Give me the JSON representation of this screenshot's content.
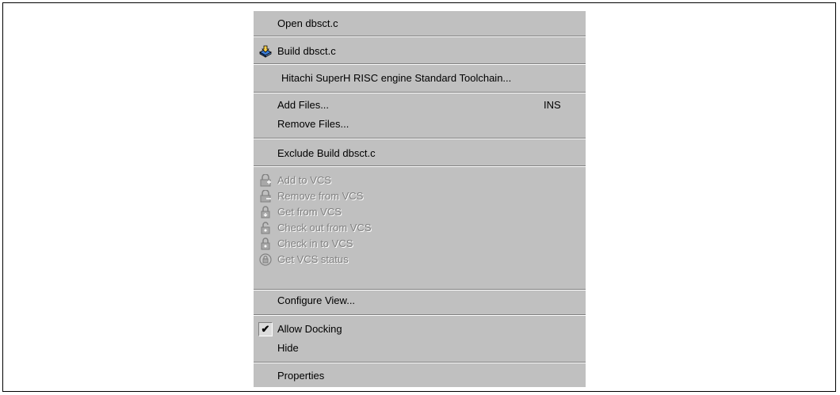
{
  "menu": {
    "open": "Open dbsct.c",
    "build": "Build dbsct.c",
    "toolchain": "Hitachi SuperH RISC engine Standard Toolchain...",
    "add_files": "Add Files...",
    "add_files_shortcut": "INS",
    "remove_files": "Remove Files...",
    "exclude_build": "Exclude Build dbsct.c",
    "vcs": {
      "add": "Add to VCS",
      "remove": "Remove from VCS",
      "get": "Get from VCS",
      "check_out": "Check out from VCS",
      "check_in": "Check in to VCS",
      "status": "Get VCS status"
    },
    "configure_view": "Configure View...",
    "allow_docking": "Allow Docking",
    "allow_docking_checked": "✔",
    "hide": "Hide",
    "properties": "Properties"
  },
  "icons": {
    "build": "build-icon",
    "vcs_add": "vcs-add-icon",
    "vcs_remove": "vcs-remove-icon",
    "vcs_get": "vcs-get-icon",
    "vcs_check_out": "vcs-check-out-icon",
    "vcs_check_in": "vcs-check-in-icon",
    "vcs_status": "vcs-status-icon"
  },
  "colors": {
    "menu_bg": "#c0c0c0",
    "disabled_text": "#808080"
  }
}
